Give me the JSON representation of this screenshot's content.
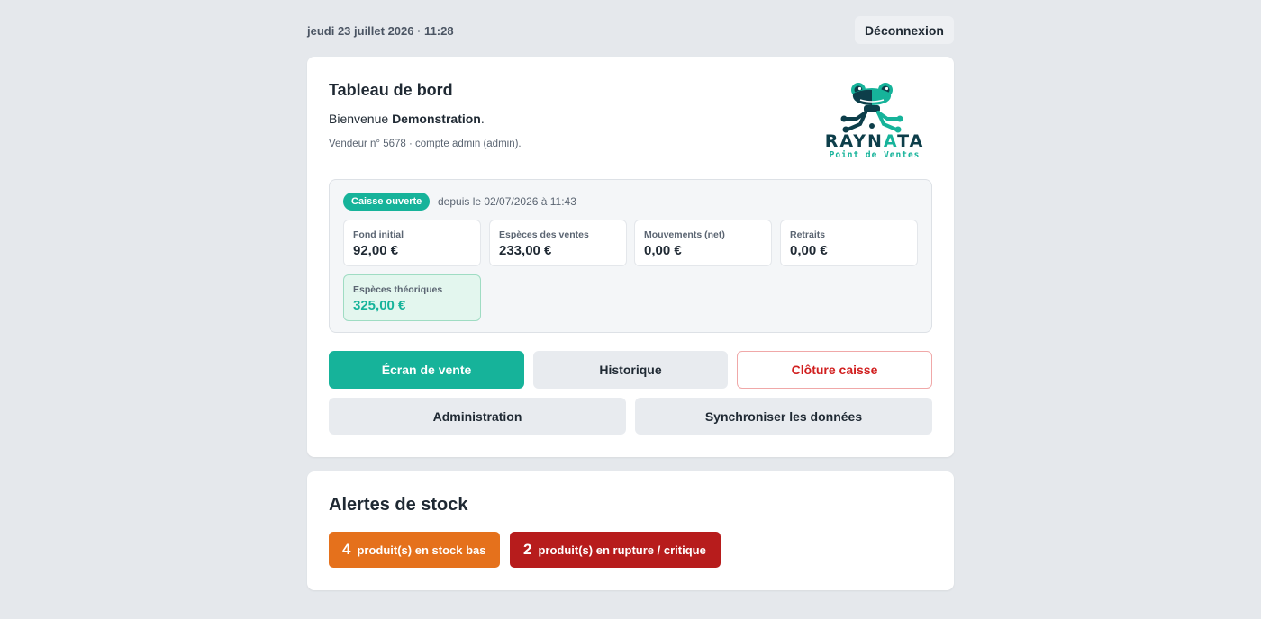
{
  "header": {
    "datetime": "jeudi 23 juillet 2026 · 11:28",
    "logout_label": "Déconnexion"
  },
  "dashboard": {
    "title": "Tableau de bord",
    "welcome_prefix": "Bienvenue ",
    "user_name": "Demonstration",
    "welcome_suffix": ".",
    "vendor_info": "Vendeur n° 5678 · compte admin (admin).",
    "logo": {
      "word_main": "RAYN",
      "word_accent": "A",
      "word_end": "TA",
      "subtitle": "Point de Ventes",
      "colors": {
        "dark": "#0d3e4a",
        "accent": "#16b39a"
      }
    }
  },
  "session": {
    "status_badge": "Caisse ouverte",
    "since": "depuis le 02/07/2026 à 11:43",
    "stats": [
      {
        "label": "Fond initial",
        "value": "92,00 €"
      },
      {
        "label": "Espèces des ventes",
        "value": "233,00 €"
      },
      {
        "label": "Mouvements (net)",
        "value": "0,00 €"
      },
      {
        "label": "Retraits",
        "value": "0,00 €"
      }
    ],
    "theoretical": {
      "label": "Espèces théoriques",
      "value": "325,00 €"
    }
  },
  "actions": {
    "sale_screen": "Écran de vente",
    "history": "Historique",
    "close_register": "Clôture caisse",
    "administration": "Administration",
    "sync": "Synchroniser les données"
  },
  "stock_alerts": {
    "title": "Alertes de stock",
    "low": {
      "count": "4",
      "label": "produit(s) en stock bas"
    },
    "critical": {
      "count": "2",
      "label": "produit(s) en rupture / critique"
    }
  },
  "colors": {
    "accent": "#16b39a",
    "danger": "#d11f1f",
    "warning": "#e5711c",
    "critical": "#b71c1c"
  }
}
